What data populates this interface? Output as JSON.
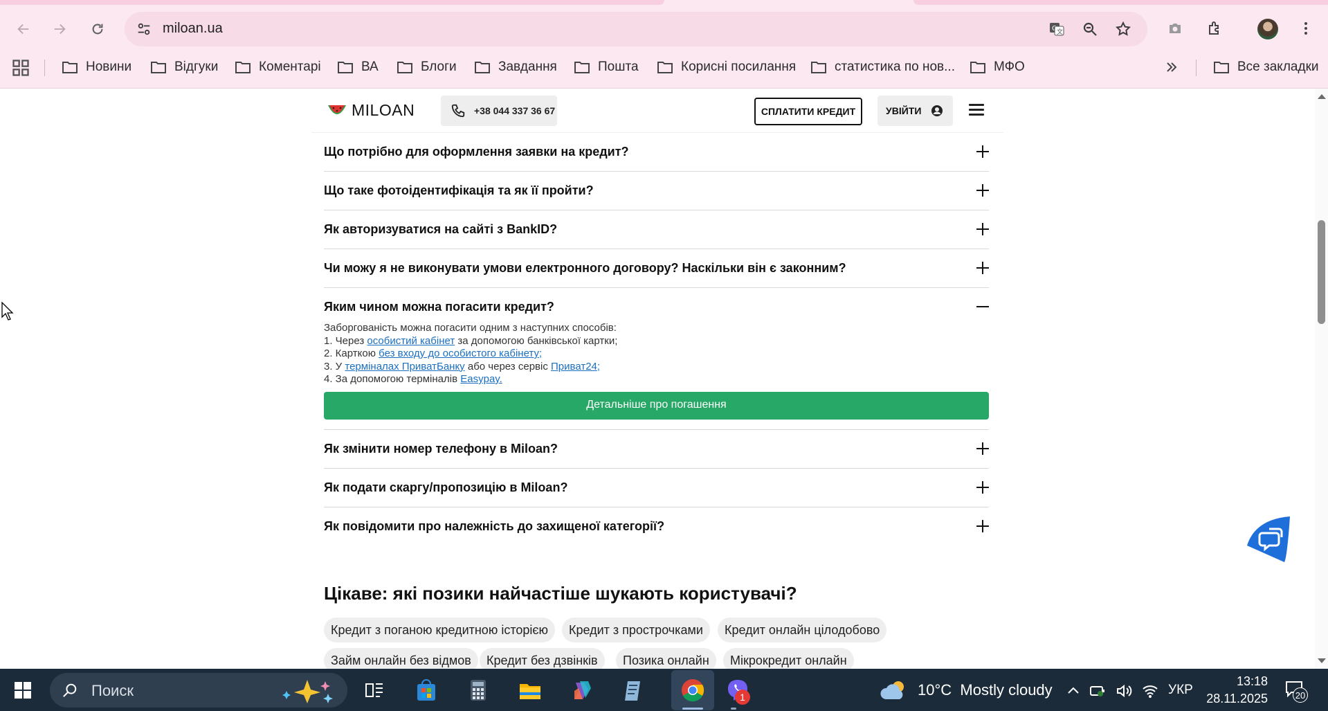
{
  "browser": {
    "url": "miloan.ua",
    "bookmarks": [
      "Новини",
      "Відгуки",
      "Коментарі",
      "ВА",
      "Блоги",
      "Завдання",
      "Пошта",
      "Корисні посилання",
      "статистика по нов...",
      "МФО"
    ],
    "all_bookmarks_label": "Все закладки",
    "icons": [
      "back-icon",
      "forward-icon",
      "reload-icon",
      "site-info-icon",
      "translate-icon",
      "zoom-icon",
      "bookmark-star-icon",
      "screenshot-icon",
      "extensions-icon",
      "profile-avatar",
      "menu-icon"
    ]
  },
  "site": {
    "logo_text": "MILOAN",
    "phone": "+38 044 337 36 67",
    "pay_label": "СПЛАТИТИ КРЕДИТ",
    "login_label": "УВІЙТИ"
  },
  "faq": {
    "items": [
      {
        "q": "Що потрібно для оформлення заявки на кредит?"
      },
      {
        "q": "Що таке фотоідентифікація та як її пройти?"
      },
      {
        "q": "Як авторизуватися на сайті з BankID?"
      },
      {
        "q": "Чи можу я не виконувати умови електронного договору? Наскільки він є законним?"
      },
      {
        "q": "Яким чином можна погасити кредит?"
      },
      {
        "q": "Як змінити номер телефону в Miloan?"
      },
      {
        "q": "Як подати скаргу/пропозицію в Miloan?"
      },
      {
        "q": "Як повідомити про належність до захищеної категорії?"
      }
    ],
    "answer": {
      "intro": "Заборгованість можна погасити одним з наступних способів:",
      "l1_pre": "1. Через ",
      "l1_link": "особистий кабінет",
      "l1_post": " за допомогою банківської картки;",
      "l2_pre": "2. Карткою ",
      "l2_link": "без входу до особистого кабінету",
      "l2_post": ";",
      "l3_pre": "3. У ",
      "l3_link1": "терміналах ПриватБанку",
      "l3_mid": " або через сервіс ",
      "l3_link2": "Приват24",
      "l3_post": ";",
      "l4_pre": "4. За допомогою терміналів ",
      "l4_link": "Easypay.",
      "button": "Детальніше про погашення"
    }
  },
  "popular": {
    "title": "Цікаве: які позики найчастіше шукають користувачі?",
    "tags": [
      "Кредит з поганою кредитною історією",
      "Кредит з прострочками",
      "Кредит онлайн цілодобово",
      "Займ онлайн без відмов",
      "Кредит без дзвінків",
      "Позика онлайн",
      "Мікрокредит онлайн"
    ]
  },
  "taskbar": {
    "search_placeholder": "Поиск",
    "weather_temp": "10°C",
    "weather_desc": "Mostly cloudy",
    "language": "УКР",
    "time": "13:18",
    "date": "28.11.2025",
    "viber_badge": "1",
    "notifications": "20"
  },
  "colors": {
    "accent_green": "#27a866",
    "link_blue": "#1a6fc1",
    "chrome_pink": "#fce8f1",
    "chat_blue": "#1e6fd9"
  }
}
